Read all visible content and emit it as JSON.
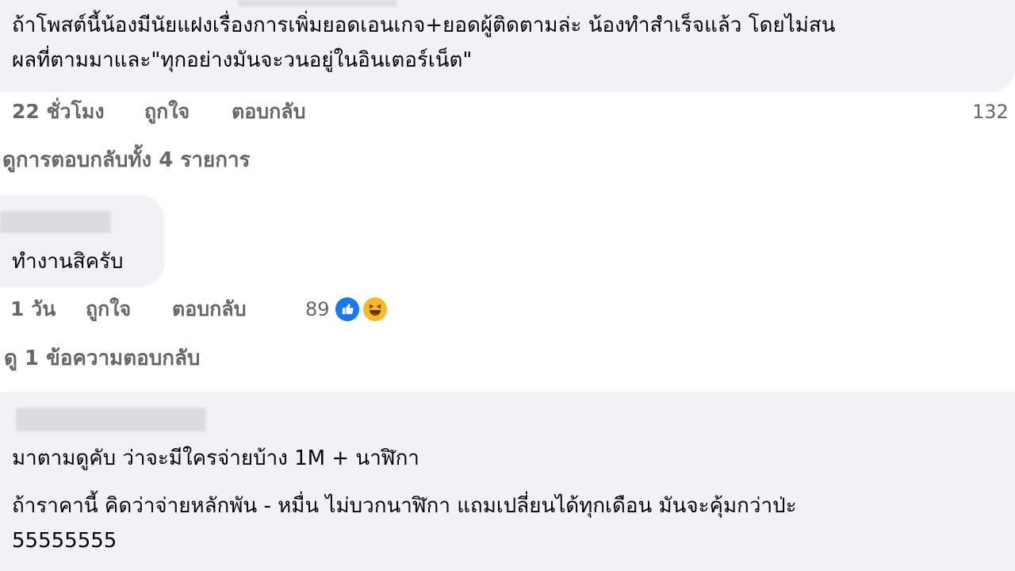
{
  "comments": [
    {
      "text_lines": [
        "ถ้าโพสต์นี้น้องมีนัยแฝงเรื่องการเพิ่มยอดเอนเกจ+ยอดผู้ติดตามล่ะ น้องทำสำเร็จแล้ว โดยไม่สน",
        "ผลที่ตามมาและ\"ทุกอย่างมันจะวนอยู่ในอินเตอร์เน็ต\""
      ],
      "time": "22 ชั่วโมง",
      "like_label": "ถูกใจ",
      "reply_label": "ตอบกลับ",
      "reaction_count": "132",
      "view_replies": "ดูการตอบกลับทั้ง 4 รายการ"
    },
    {
      "text_lines": [
        "ทำงานสิครับ"
      ],
      "time": "1 วัน",
      "like_label": "ถูกใจ",
      "reply_label": "ตอบกลับ",
      "reaction_count": "89",
      "reactions": [
        "like-icon",
        "haha-icon"
      ],
      "view_replies": "ดู 1 ข้อความตอบกลับ"
    },
    {
      "text_lines": [
        "มาตามดูคับ ว่าจะมีใครจ่ายบ้าง 1M + นาฬิกา",
        "ถ้าราคานี้ คิดว่าจ่ายหลักพัน - หมื่น ไม่บวกนาฬิกา แถมเปลี่ยนได้ทุกเดือน มันจะคุ้มกว่าป่ะ",
        "55555555"
      ]
    }
  ],
  "colors": {
    "bubble": "#f0f2f5",
    "meta": "#65676b",
    "like": "#1877f2",
    "haha": "#f7b928"
  }
}
